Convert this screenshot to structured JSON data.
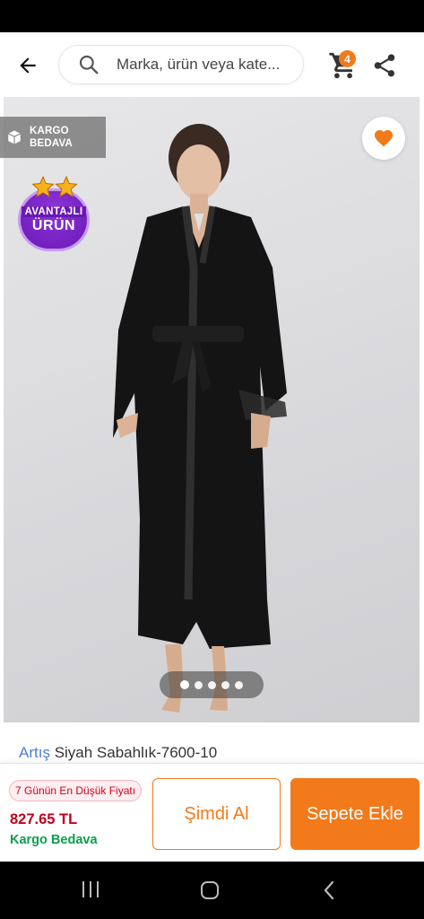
{
  "header": {
    "search_placeholder": "Marka, ürün veya kate...",
    "cart_count": "4"
  },
  "product": {
    "cargo_badge_line1": "KARGO",
    "cargo_badge_line2": "BEDAVA",
    "advantage_badge_line1": "AVANTAJLI",
    "advantage_badge_line2": "ÜRÜN",
    "brand": "Artış",
    "name": "Siyah Sabahlık-7600-10",
    "image_count": 5,
    "active_image_index": 0
  },
  "purchase": {
    "lowest_price_label": "7 Günün En Düşük Fiyatı",
    "price": "827.65 TL",
    "shipping": "Kargo Bedava",
    "buy_now_label": "Şimdi Al",
    "add_to_cart_label": "Sepete Ekle"
  },
  "colors": {
    "accent": "#f27a1a",
    "brand_link": "#4a7fd1",
    "price": "#c0001a",
    "free_shipping": "#0b9e4b",
    "advantage_purple": "#6a17b5"
  },
  "icons": {
    "back": "arrow-left-icon",
    "search": "search-icon",
    "cart": "cart-icon",
    "share": "share-icon",
    "favorite": "heart-icon",
    "cargo": "box-icon",
    "stars": "star-icon"
  }
}
